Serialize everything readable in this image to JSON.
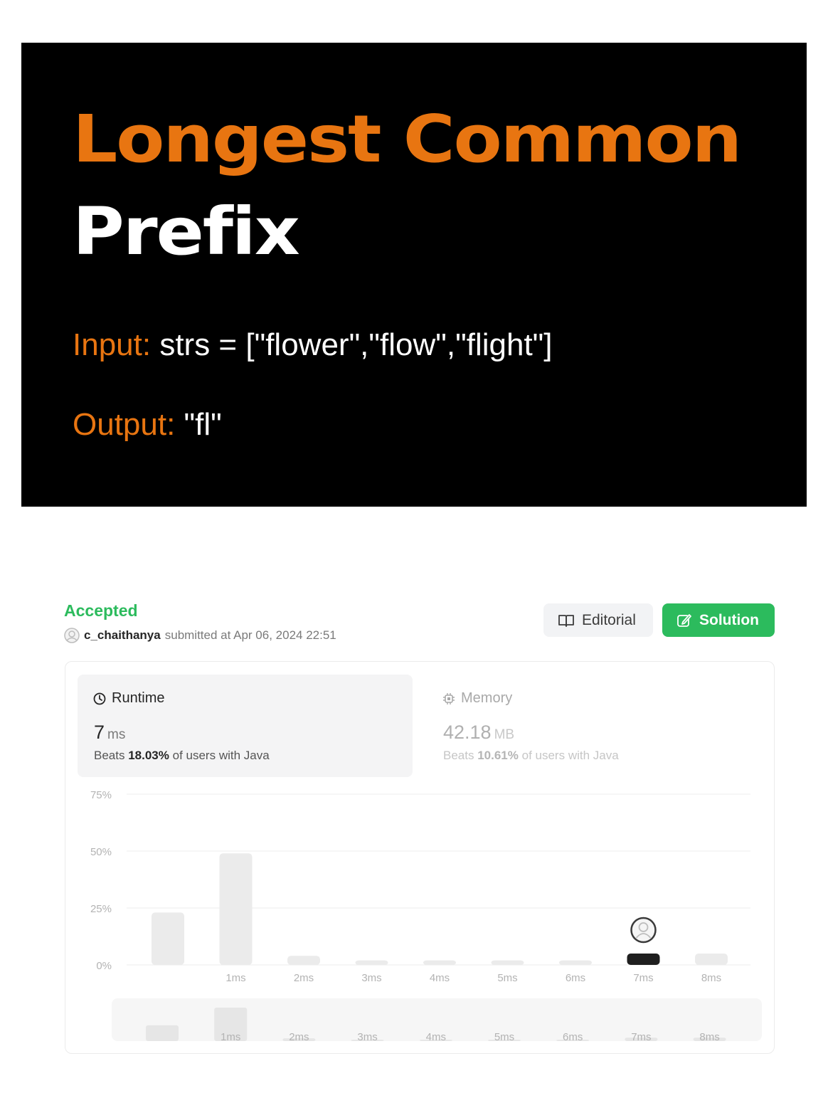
{
  "banner": {
    "title_line1": "Longest Common",
    "title_line2": "Prefix",
    "input_label": "Input:",
    "input_value": "strs = [\"flower\",\"flow\",\"flight\"]",
    "output_label": "Output:",
    "output_value": "\"fl\""
  },
  "submission": {
    "status": "Accepted",
    "user": "c_chaithanya",
    "submitted_text": "submitted at Apr 06, 2024 22:51",
    "editorial_label": "Editorial",
    "solution_label": "Solution"
  },
  "runtime": {
    "label": "Runtime",
    "value": "7",
    "unit": "ms",
    "beats_prefix": "Beats",
    "beats_pct": "18.03%",
    "beats_suffix": "of users with Java"
  },
  "memory": {
    "label": "Memory",
    "value": "42.18",
    "unit": "MB",
    "beats_prefix": "Beats",
    "beats_pct": "10.61%",
    "beats_suffix": "of users with Java"
  },
  "colors": {
    "accent_orange": "#e87511",
    "accepted_green": "#2cbb5d",
    "bar_grey": "#ebebeb",
    "bar_selected": "#1f1f1f"
  },
  "chart_data": {
    "type": "bar",
    "categories": [
      "",
      "1ms",
      "2ms",
      "3ms",
      "4ms",
      "5ms",
      "6ms",
      "7ms",
      "8ms"
    ],
    "values": [
      23,
      49,
      4,
      2,
      2,
      2,
      2,
      5,
      5
    ],
    "y_ticks": [
      "0%",
      "25%",
      "50%",
      "75%"
    ],
    "ylim": [
      0,
      75
    ],
    "highlight_category": "7ms",
    "grid": true
  }
}
